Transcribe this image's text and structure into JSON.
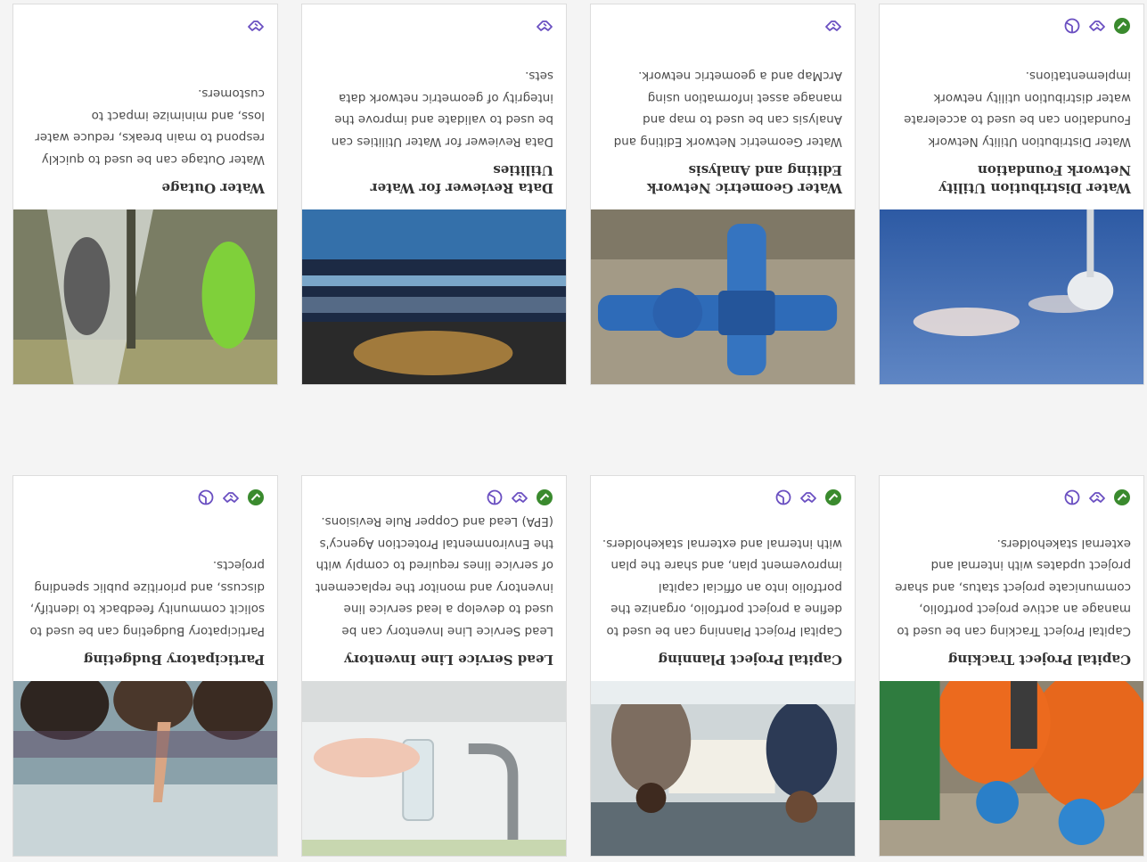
{
  "cards": [
    {
      "title": "Capital Project Tracking",
      "description": "Capital Project Tracking can be used to manage an active project portfolio, communicate project status, and share project updates with internal and external stakeholders.",
      "icons": [
        "check-circle-icon",
        "handshake-icon",
        "pie-chart-icon"
      ]
    },
    {
      "title": "Capital Project Planning",
      "description": "Capital Project Planning can be used to define a project portfolio, organize the portfolio into an official capital improvement plan, and share the plan with internal and external stakeholders.",
      "icons": [
        "check-circle-icon",
        "handshake-icon",
        "pie-chart-icon"
      ]
    },
    {
      "title": "Lead Service Line Inventory",
      "description": "Lead Service Line Inventory can be used to develop a lead service line inventory and monitor the replacement of service lines required to comply with the Environmental Protection Agency's (EPA) Lead and Copper Rule Revisions.",
      "icons": [
        "check-circle-icon",
        "handshake-icon",
        "pie-chart-icon"
      ]
    },
    {
      "title": "Participatory Budgeting",
      "description": "Participatory Budgeting can be used to solicit community feedback to identify, discuss, and prioritize public spending projects.",
      "icons": [
        "check-circle-icon",
        "handshake-icon",
        "pie-chart-icon"
      ]
    },
    {
      "title": "Water Distribution Utility Network Foundation",
      "description": "Water Distribution Utility Network Foundation can be used to accelerate water distribution utility network implementations.",
      "icons": [
        "check-circle-icon",
        "handshake-icon",
        "pie-chart-icon"
      ]
    },
    {
      "title": "Water Geometric Network Editing and Analysis",
      "description": "Water Geometric Network Editing and Analysis can be used to map and manage asset information using ArcMap and a geometric network.",
      "icons": [
        "handshake-icon"
      ]
    },
    {
      "title": "Data Reviewer for Water Utilities",
      "description": "Data Reviewer for Water Utilities can be used to validate and improve the integrity of geometric network data sets.",
      "icons": [
        "handshake-icon"
      ]
    },
    {
      "title": "Water Outage",
      "description": "Water Outage can be used to quickly respond to main breaks, reduce water loss, and minimize impact to customers.",
      "icons": [
        "handshake-icon"
      ]
    }
  ]
}
